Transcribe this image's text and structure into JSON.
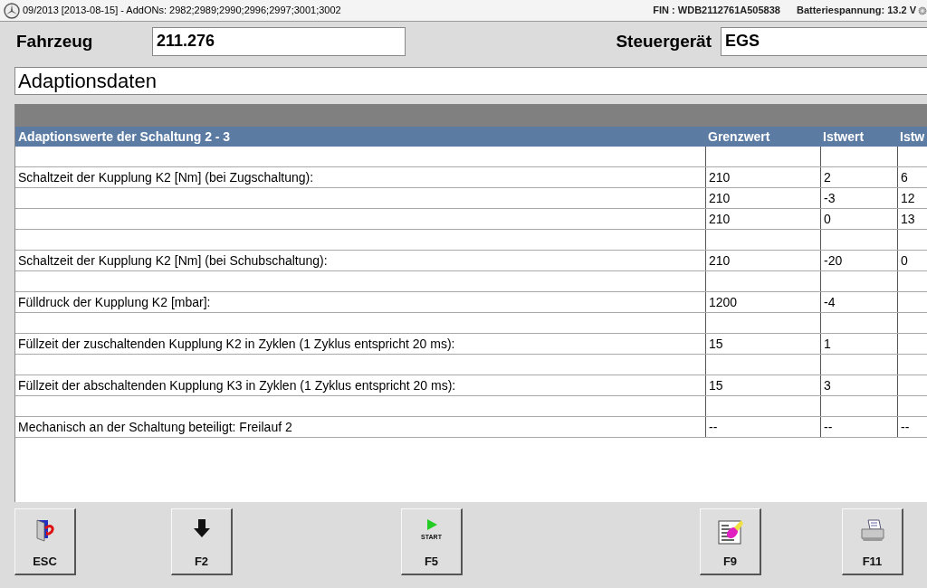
{
  "title_bar": {
    "title": "09/2013 [2013-08-15] - AddONs: 2982;2989;2990;2996;2997;3001;3002",
    "fin": "FIN : WDB2112761A505838",
    "battery": "Batteriespannung: 13.2 V"
  },
  "vehicle": {
    "label": "Fahrzeug",
    "value": "211.276"
  },
  "control_unit": {
    "label": "Steuergerät",
    "value": "EGS"
  },
  "section_title": "Adaptionsdaten",
  "table": {
    "columns": [
      "Adaptionswerte der Schaltung 2 - 3",
      "Grenzwert",
      "Istwert",
      "Istw"
    ],
    "rows": [
      {
        "kind": "blank"
      },
      {
        "kind": "data",
        "cells": [
          "Schaltzeit der Kupplung K2 [Nm] (bei Zugschaltung):",
          "210",
          "2",
          "6"
        ]
      },
      {
        "kind": "data",
        "cells": [
          null,
          "210",
          "-3",
          "12"
        ]
      },
      {
        "kind": "data",
        "cells": [
          null,
          "210",
          "0",
          "13"
        ]
      },
      {
        "kind": "blank"
      },
      {
        "kind": "data",
        "cells": [
          "Schaltzeit der Kupplung K2 [Nm] (bei Schubschaltung):",
          "210",
          "-20",
          "0"
        ]
      },
      {
        "kind": "blank"
      },
      {
        "kind": "data",
        "cells": [
          "Fülldruck der Kupplung K2 [mbar]:",
          "1200",
          "-4",
          null
        ]
      },
      {
        "kind": "blank"
      },
      {
        "kind": "data",
        "cells": [
          "Füllzeit der zuschaltenden Kupplung K2 in Zyklen (1 Zyklus entspricht 20 ms):",
          "15",
          "1",
          null
        ]
      },
      {
        "kind": "blank"
      },
      {
        "kind": "data",
        "cells": [
          "Füllzeit der abschaltenden Kupplung K3 in Zyklen (1 Zyklus entspricht 20 ms):",
          "15",
          "3",
          null
        ]
      },
      {
        "kind": "blank"
      },
      {
        "kind": "data",
        "cells": [
          "Mechanisch an der Schaltung beteiligt: Freilauf 2",
          "--",
          "--",
          "--"
        ]
      }
    ]
  },
  "buttons": [
    {
      "kind": "exit",
      "label": "ESC"
    },
    {
      "kind": "down",
      "label": "F2"
    },
    {
      "kind": "start",
      "label": "F5",
      "icon_text": "START"
    },
    {
      "kind": "report",
      "label": "F9"
    },
    {
      "kind": "print",
      "label": "F11"
    }
  ]
}
